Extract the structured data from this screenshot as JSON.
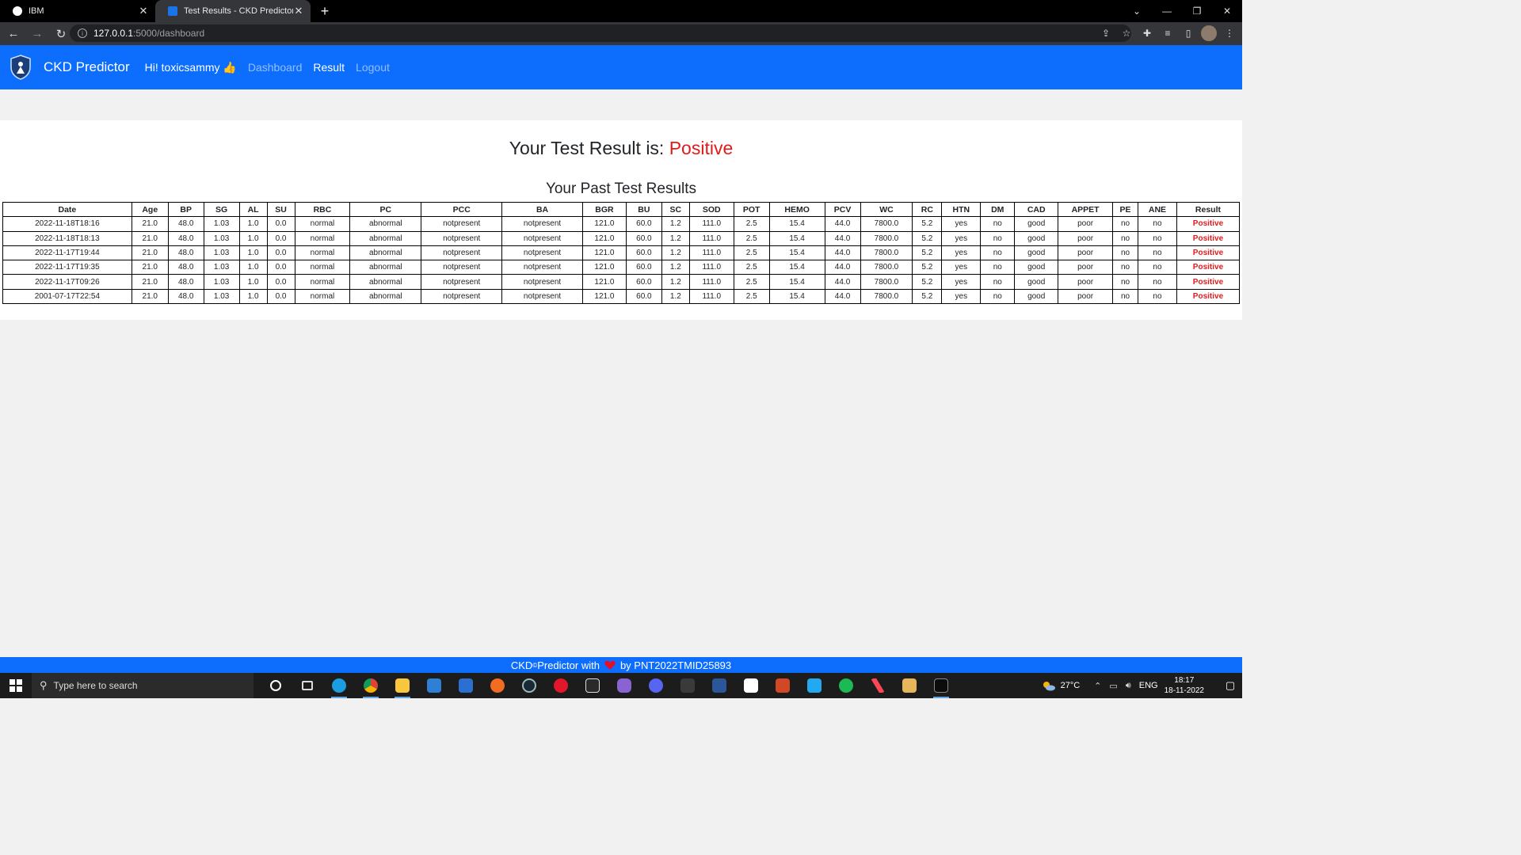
{
  "browser": {
    "tabs": [
      {
        "title": "IBM",
        "active": false
      },
      {
        "title": "Test Results - CKD Predictor",
        "active": true
      }
    ],
    "url_host": "127.0.0.1",
    "url_path": ":5000/dashboard"
  },
  "navbar": {
    "brand": "CKD Predictor",
    "greeting": "Hi! toxicsammy 👍",
    "links": [
      "Dashboard",
      "Result",
      "Logout"
    ],
    "active_link": "Result"
  },
  "result": {
    "label": "Your Test Result is: ",
    "value": "Positive"
  },
  "past": {
    "title": "Your Past Test Results",
    "columns": [
      "Date",
      "Age",
      "BP",
      "SG",
      "AL",
      "SU",
      "RBC",
      "PC",
      "PCC",
      "BA",
      "BGR",
      "BU",
      "SC",
      "SOD",
      "POT",
      "HEMO",
      "PCV",
      "WC",
      "RC",
      "HTN",
      "DM",
      "CAD",
      "APPET",
      "PE",
      "ANE",
      "Result"
    ],
    "rows": [
      [
        "2022-11-18T18:16",
        "21.0",
        "48.0",
        "1.03",
        "1.0",
        "0.0",
        "normal",
        "abnormal",
        "notpresent",
        "notpresent",
        "121.0",
        "60.0",
        "1.2",
        "111.0",
        "2.5",
        "15.4",
        "44.0",
        "7800.0",
        "5.2",
        "yes",
        "no",
        "good",
        "poor",
        "no",
        "no",
        "Positive"
      ],
      [
        "2022-11-18T18:13",
        "21.0",
        "48.0",
        "1.03",
        "1.0",
        "0.0",
        "normal",
        "abnormal",
        "notpresent",
        "notpresent",
        "121.0",
        "60.0",
        "1.2",
        "111.0",
        "2.5",
        "15.4",
        "44.0",
        "7800.0",
        "5.2",
        "yes",
        "no",
        "good",
        "poor",
        "no",
        "no",
        "Positive"
      ],
      [
        "2022-11-17T19:44",
        "21.0",
        "48.0",
        "1.03",
        "1.0",
        "0.0",
        "normal",
        "abnormal",
        "notpresent",
        "notpresent",
        "121.0",
        "60.0",
        "1.2",
        "111.0",
        "2.5",
        "15.4",
        "44.0",
        "7800.0",
        "5.2",
        "yes",
        "no",
        "good",
        "poor",
        "no",
        "no",
        "Positive"
      ],
      [
        "2022-11-17T19:35",
        "21.0",
        "48.0",
        "1.03",
        "1.0",
        "0.0",
        "normal",
        "abnormal",
        "notpresent",
        "notpresent",
        "121.0",
        "60.0",
        "1.2",
        "111.0",
        "2.5",
        "15.4",
        "44.0",
        "7800.0",
        "5.2",
        "yes",
        "no",
        "good",
        "poor",
        "no",
        "no",
        "Positive"
      ],
      [
        "2022-11-17T09:26",
        "21.0",
        "48.0",
        "1.03",
        "1.0",
        "0.0",
        "normal",
        "abnormal",
        "notpresent",
        "notpresent",
        "121.0",
        "60.0",
        "1.2",
        "111.0",
        "2.5",
        "15.4",
        "44.0",
        "7800.0",
        "5.2",
        "yes",
        "no",
        "good",
        "poor",
        "no",
        "no",
        "Positive"
      ],
      [
        "2001-07-17T22:54",
        "21.0",
        "48.0",
        "1.03",
        "1.0",
        "0.0",
        "normal",
        "abnormal",
        "notpresent",
        "notpresent",
        "121.0",
        "60.0",
        "1.2",
        "111.0",
        "2.5",
        "15.4",
        "44.0",
        "7800.0",
        "5.2",
        "yes",
        "no",
        "good",
        "poor",
        "no",
        "no",
        "Positive"
      ]
    ]
  },
  "footer": {
    "prefix": "CKD",
    "sup": "©",
    "middle": " Predictor with",
    "suffix": "by PNT2022TMID25893"
  },
  "taskbar": {
    "search_placeholder": "Type here to search",
    "apps": [
      "cortana",
      "task-view",
      "edge",
      "chrome",
      "file-explorer",
      "mail",
      "store",
      "origin",
      "steam",
      "app-red",
      "epic-games",
      "gamepad",
      "discord",
      "davinci",
      "word",
      "itunes",
      "powerpoint",
      "vscode",
      "spotify",
      "valorant",
      "folder-app",
      "terminal"
    ],
    "weather": "27°C",
    "lang": "ENG",
    "time": "18:17",
    "date": "18-11-2022"
  },
  "colors": {
    "brand_blue": "#0d6efd",
    "positive_red": "#e01b1b"
  }
}
